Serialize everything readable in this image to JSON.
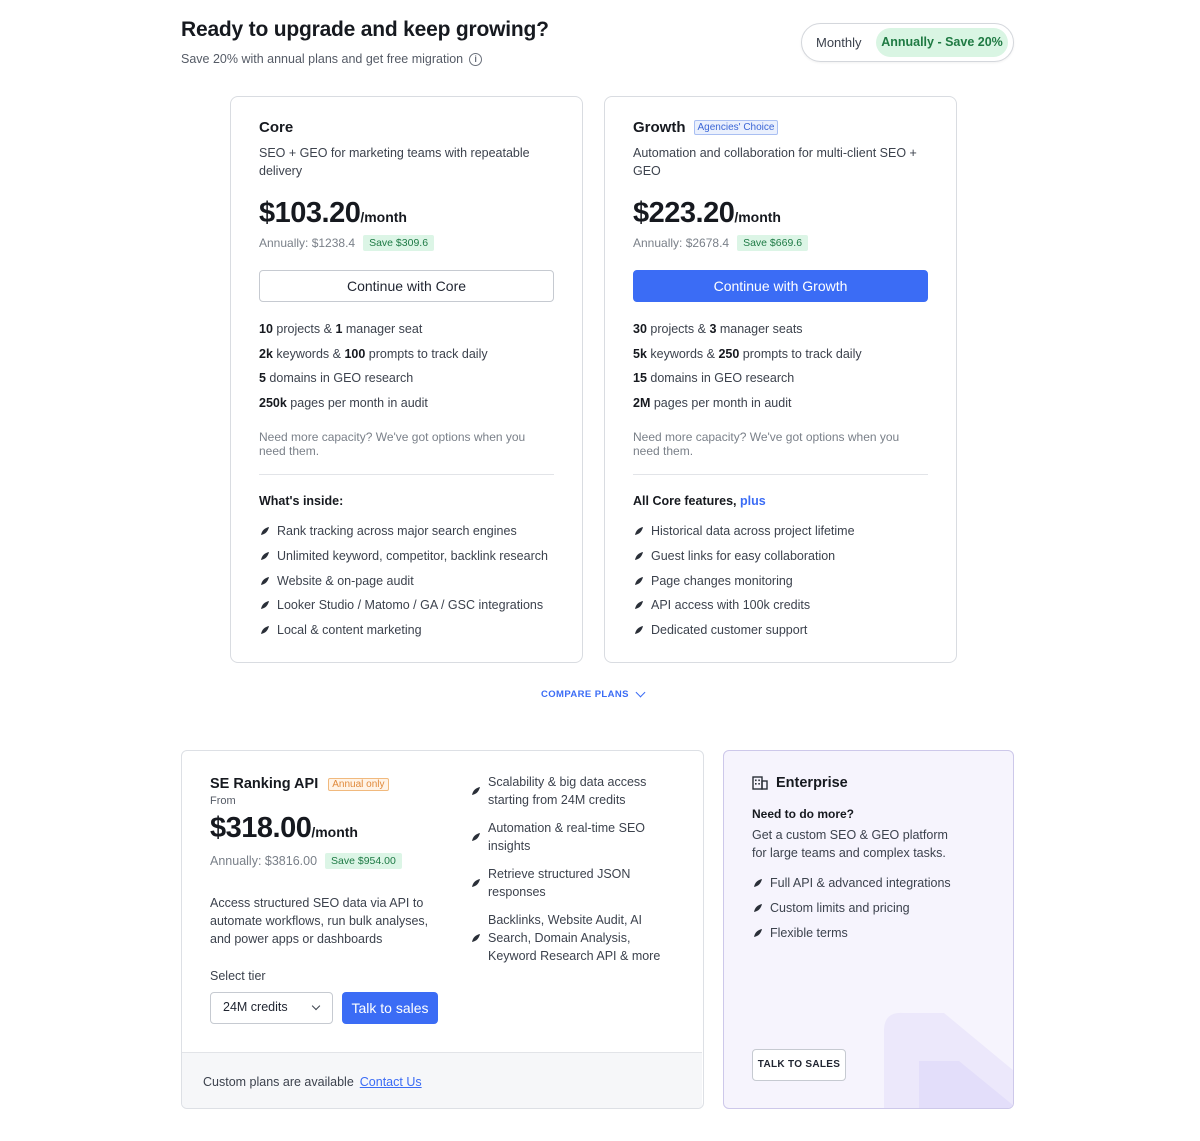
{
  "header": {
    "title": "Ready to upgrade and keep growing?",
    "subtitle": "Save 20% with annual plans and get free migration",
    "info_icon": "ⓘ"
  },
  "billing_toggle": {
    "monthly_label": "Monthly",
    "annual_label": "Annually - Save 20%",
    "selected": "annual"
  },
  "plans": [
    {
      "name": "Core",
      "badge": "",
      "description": "SEO + GEO for marketing teams with repeatable delivery",
      "price": "$103.20",
      "price_unit": "/month",
      "annual": "Annually: $1238.4",
      "save": "Save $309.6",
      "cta": "Continue with Core",
      "quotas": [
        {
          "b1": "10",
          "t1": " projects & ",
          "b2": "1",
          "t2": " manager seat"
        },
        {
          "b1": "2k",
          "t1": " keywords & ",
          "b2": "100",
          "t2": " prompts to track daily"
        },
        {
          "b1": "5",
          "t1": " domains in GEO research",
          "b2": "",
          "t2": ""
        },
        {
          "b1": "250k",
          "t1": " pages per month in audit",
          "b2": "",
          "t2": ""
        }
      ],
      "capacity_note": "Need more capacity? We've got options when you need them.",
      "inside_title": "What's inside:",
      "inside_plus": "",
      "features": [
        "Rank tracking across major search engines",
        "Unlimited keyword, competitor, backlink research",
        "Website & on-page audit",
        "Looker Studio / Matomo / GA / GSC integrations",
        "Local & content marketing"
      ]
    },
    {
      "name": "Growth",
      "badge": "Agencies' Choice",
      "description": "Automation and collaboration for multi-client SEO + GEO",
      "price": "$223.20",
      "price_unit": "/month",
      "annual": "Annually: $2678.4",
      "save": "Save $669.6",
      "cta": "Continue with Growth",
      "quotas": [
        {
          "b1": "30",
          "t1": " projects & ",
          "b2": "3",
          "t2": " manager seats"
        },
        {
          "b1": "5k",
          "t1": " keywords & ",
          "b2": "250",
          "t2": " prompts to track daily"
        },
        {
          "b1": "15",
          "t1": " domains in GEO research",
          "b2": "",
          "t2": ""
        },
        {
          "b1": "2M",
          "t1": " pages per month in audit",
          "b2": "",
          "t2": ""
        }
      ],
      "capacity_note": "Need more capacity? We've got options when you need them.",
      "inside_title": "All Core features, ",
      "inside_plus": "plus",
      "features": [
        "Historical data across project lifetime",
        "Guest links for easy collaboration",
        "Page changes monitoring",
        "API access with 100k credits",
        "Dedicated customer support"
      ]
    }
  ],
  "compare_label": "COMPARE PLANS",
  "api": {
    "name": "SE Ranking API",
    "badge": "Annual only",
    "from": "From",
    "price": "$318.00",
    "price_unit": "/month",
    "annual": "Annually: $3816.00",
    "save": "Save $954.00",
    "description": "Access structured SEO data via API to automate workflows, run bulk analyses, and power apps or dashboards",
    "tier_label": "Select tier",
    "tier_value": "24M credits",
    "cta": "Talk to sales",
    "features": [
      "Scalability & big data access starting from 24M credits",
      "Automation & real-time SEO insights",
      "Retrieve structured JSON responses",
      "Backlinks, Website Audit, AI Search, Domain Analysis, Keyword Research API & more"
    ],
    "footer_text": "Custom plans are available",
    "footer_link": "Contact Us"
  },
  "enterprise": {
    "title": "Enterprise",
    "subtitle": "Need to do more?",
    "description": "Get a custom SEO & GEO platform for large teams and complex tasks.",
    "features": [
      "Full API & advanced integrations",
      "Custom limits and pricing",
      "Flexible terms"
    ],
    "cta": "TALK TO SALES"
  },
  "colors": {
    "primary": "#3b6cf5",
    "save_green": "#1e7a45",
    "save_bg": "#dcf5e6",
    "enterprise_bg": "#f6f4fd"
  },
  "icons": {
    "feature": "leaf-icon",
    "enterprise": "building-icon",
    "compare": "chevron-down-icon"
  }
}
